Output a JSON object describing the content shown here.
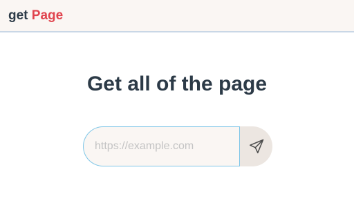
{
  "header": {
    "brand_prefix": "get ",
    "brand_accent": "Page"
  },
  "main": {
    "headline": "Get all of the page",
    "url_input": {
      "value": "",
      "placeholder": "https://example.com"
    },
    "submit_icon": "paper-plane-send-icon"
  },
  "colors": {
    "brand_accent": "#e0444e",
    "text_dark": "#2c3a47",
    "input_border": "#7fc6e8",
    "topbar_bg": "#faf6f3",
    "button_bg": "#ece6e1"
  }
}
